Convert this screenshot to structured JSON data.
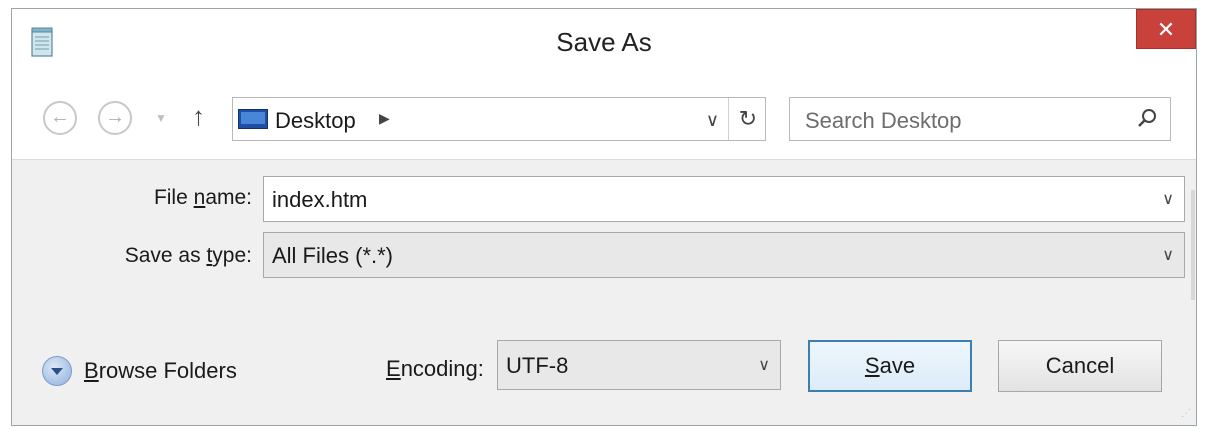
{
  "window": {
    "title": "Save As",
    "close_label": "✕"
  },
  "navigation": {
    "back_glyph": "←",
    "forward_glyph": "→",
    "recent_glyph": "▼",
    "up_glyph": "↑",
    "address": {
      "location": "Desktop",
      "separator_glyph": "▶",
      "dropdown_glyph": "∨",
      "refresh_glyph": "↻"
    },
    "search": {
      "placeholder": "Search Desktop"
    }
  },
  "form": {
    "file_name": {
      "label_prefix": "File ",
      "label_accel": "n",
      "label_suffix": "ame:",
      "value": "index.htm",
      "dropdown_glyph": "∨"
    },
    "save_as_type": {
      "label_prefix": "Save as ",
      "label_accel": "t",
      "label_suffix": "ype:",
      "value": "All Files  (*.*)",
      "dropdown_glyph": "∨"
    }
  },
  "footer": {
    "browse_folders": {
      "accel": "B",
      "suffix": "rowse Folders"
    },
    "encoding": {
      "accel": "E",
      "suffix": "ncoding:",
      "value": "UTF-8",
      "dropdown_glyph": "∨"
    },
    "save_button": {
      "accel": "S",
      "suffix": "ave"
    },
    "cancel_button": {
      "label": "Cancel"
    },
    "grip_glyph": "⋰"
  },
  "icons": {
    "app": "notepad-icon",
    "address_location": "desktop-icon",
    "search": "search-icon",
    "browse": "expand-icon"
  },
  "colors": {
    "close_button": "#c8413b",
    "default_button_border": "#3c7fb1",
    "panel_background": "#f0f0f0"
  }
}
